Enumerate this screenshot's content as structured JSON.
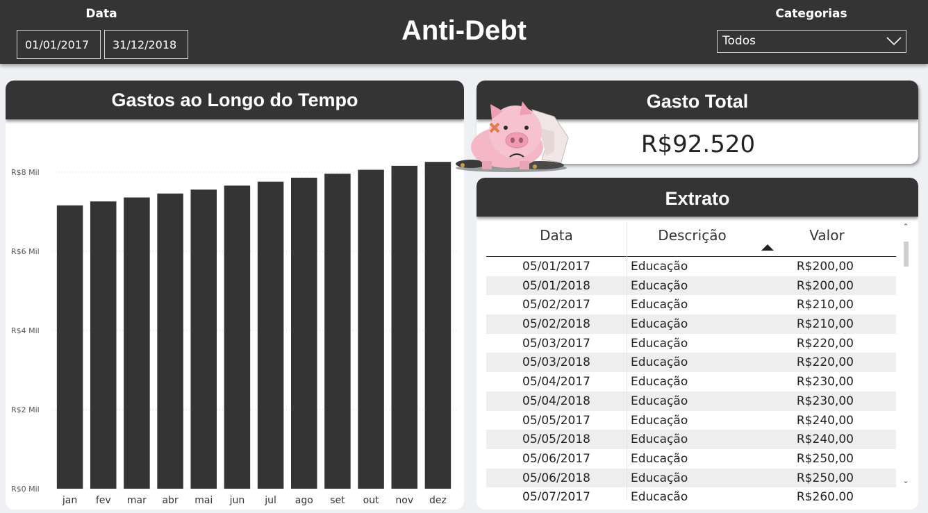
{
  "header": {
    "title": "Anti-Debt",
    "date_filter": {
      "label": "Data",
      "start": "01/01/2017",
      "end": "31/12/2018"
    },
    "category_filter": {
      "label": "Categorias",
      "selected": "Todos"
    }
  },
  "chart_panel": {
    "title": "Gastos ao Longo do Tempo"
  },
  "chart_data": {
    "type": "bar",
    "title": "Gastos ao Longo do Tempo",
    "categories": [
      "jan",
      "fev",
      "mar",
      "abr",
      "mai",
      "jun",
      "jul",
      "ago",
      "set",
      "out",
      "nov",
      "dez"
    ],
    "values": [
      7160,
      7260,
      7360,
      7460,
      7560,
      7660,
      7760,
      7860,
      7960,
      8060,
      8160,
      8260
    ],
    "y_ticks": [
      0,
      2000,
      4000,
      6000,
      8000
    ],
    "y_tick_labels": [
      "R$0 Mil",
      "R$2 Mil",
      "R$4 Mil",
      "R$6 Mil",
      "R$8 Mil"
    ],
    "ylim": [
      0,
      8000
    ],
    "xlabel": "",
    "ylabel": "",
    "grid": true,
    "bar_color": "#343434"
  },
  "total_panel": {
    "title": "Gasto Total",
    "value": "R$92.520"
  },
  "extrato": {
    "title": "Extrato",
    "columns": [
      "Data",
      "Descrição",
      "Valor"
    ],
    "sorted_column": "Descrição",
    "rows": [
      {
        "date": "05/01/2017",
        "desc": "Educação",
        "valor": "R$200,00"
      },
      {
        "date": "05/01/2018",
        "desc": "Educação",
        "valor": "R$200,00"
      },
      {
        "date": "05/02/2017",
        "desc": "Educação",
        "valor": "R$210,00"
      },
      {
        "date": "05/02/2018",
        "desc": "Educação",
        "valor": "R$210,00"
      },
      {
        "date": "05/03/2017",
        "desc": "Educação",
        "valor": "R$220,00"
      },
      {
        "date": "05/03/2018",
        "desc": "Educação",
        "valor": "R$220,00"
      },
      {
        "date": "05/04/2017",
        "desc": "Educação",
        "valor": "R$230,00"
      },
      {
        "date": "05/04/2018",
        "desc": "Educação",
        "valor": "R$230,00"
      },
      {
        "date": "05/05/2017",
        "desc": "Educação",
        "valor": "R$240,00"
      },
      {
        "date": "05/05/2018",
        "desc": "Educação",
        "valor": "R$240,00"
      },
      {
        "date": "05/06/2017",
        "desc": "Educação",
        "valor": "R$250,00"
      },
      {
        "date": "05/06/2018",
        "desc": "Educação",
        "valor": "R$250,00"
      },
      {
        "date": "05/07/2017",
        "desc": "Educação",
        "valor": "R$260,00"
      }
    ]
  },
  "icons": {
    "category_dropdown": "chevron-down-icon",
    "mascot": "broken-piggy-bank-icon",
    "scroll_up": "scroll-up-icon",
    "scroll_down": "scroll-down-icon"
  },
  "colors": {
    "header_bg": "#343434",
    "page_bg": "#eef0f3",
    "bar": "#343434",
    "alt_row": "#eeeeee"
  }
}
